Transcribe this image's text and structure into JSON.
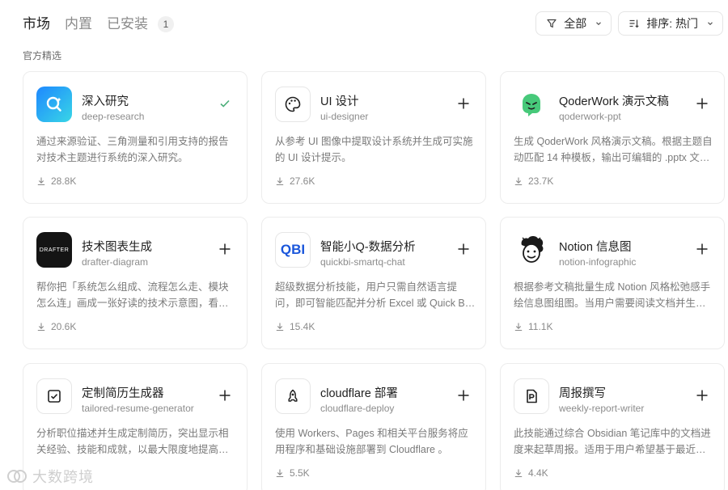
{
  "tabs": [
    {
      "label": "市场",
      "active": true
    },
    {
      "label": "内置",
      "active": false
    },
    {
      "label": "已安装",
      "active": false
    }
  ],
  "installed_count": "1",
  "filter": {
    "label": "全部",
    "icon": "filter-icon"
  },
  "sort": {
    "label": "排序: 热门",
    "icon": "sort-icon"
  },
  "section_title": "官方精选",
  "cards": [
    {
      "title": "深入研究",
      "slug": "deep-research",
      "desc": "通过来源验证、三角测量和引用支持的报告对技术主题进行系统的深入研究。",
      "downloads": "28.8K",
      "installed": true,
      "icon": "deep-research-icon"
    },
    {
      "title": "UI 设计",
      "slug": "ui-designer",
      "desc": "从参考 UI 图像中提取设计系统并生成可实施的 UI 设计提示。",
      "downloads": "27.6K",
      "installed": false,
      "icon": "palette-icon"
    },
    {
      "title": "QoderWork 演示文稿",
      "slug": "qoderwork-ppt",
      "desc": "生成 QoderWork 风格演示文稿。根据主题自动匹配 14 种模板，输出可编辑的 .pptx 文件。",
      "downloads": "23.7K",
      "installed": false,
      "icon": "qoder-mascot-icon"
    },
    {
      "title": "技术图表生成",
      "slug": "drafter-diagram",
      "desc": "帮你把「系统怎么组成、流程怎么走、模块怎么连」画成一张好读的技术示意图，看得懂的图。",
      "downloads": "20.6K",
      "installed": false,
      "icon": "drafter-logo-icon",
      "icon_text": "DRAFTER"
    },
    {
      "title": "智能小Q-数据分析",
      "slug": "quickbi-smartq-chat",
      "desc": "超级数据分析技能，用户只需自然语言提问，即可智能匹配并分析 Excel 或 Quick BI 数据。",
      "downloads": "15.4K",
      "installed": false,
      "icon": "quickbi-logo-icon",
      "icon_text": "QBI"
    },
    {
      "title": "Notion 信息图",
      "slug": "notion-infographic",
      "desc": "根据参考文稿批量生成 Notion 风格松弛感手绘信息图组图。当用户需要阅读文档并生成信息图时使用。",
      "downloads": "11.1K",
      "installed": false,
      "icon": "notion-face-icon"
    },
    {
      "title": "定制简历生成器",
      "slug": "tailored-resume-generator",
      "desc": "分析职位描述并生成定制简历，突出显示相关经验、技能和成就，以最大限度地提高面试机会。",
      "downloads": "",
      "installed": false,
      "icon": "checkbox-doc-icon"
    },
    {
      "title": "cloudflare 部署",
      "slug": "cloudflare-deploy",
      "desc": "使用 Workers、Pages 和相关平台服务将应用程序和基础设施部署到 Cloudflare 。",
      "downloads": "5.5K",
      "installed": false,
      "icon": "rocket-icon"
    },
    {
      "title": "周报撰写",
      "slug": "weekly-report-writer",
      "desc": "此技能通过综合 Obsidian 笔记库中的文档进度来起草周报。适用于用户希望基于最近工作生成周报时。",
      "downloads": "4.4K",
      "installed": false,
      "icon": "report-doc-icon"
    }
  ],
  "watermark": "大数跨境",
  "colors": {
    "accent_check": "#4caf7a",
    "deep_research_gradient_a": "#1e88ff",
    "deep_research_gradient_b": "#38d6e6",
    "qoder_green": "#47c97a"
  }
}
